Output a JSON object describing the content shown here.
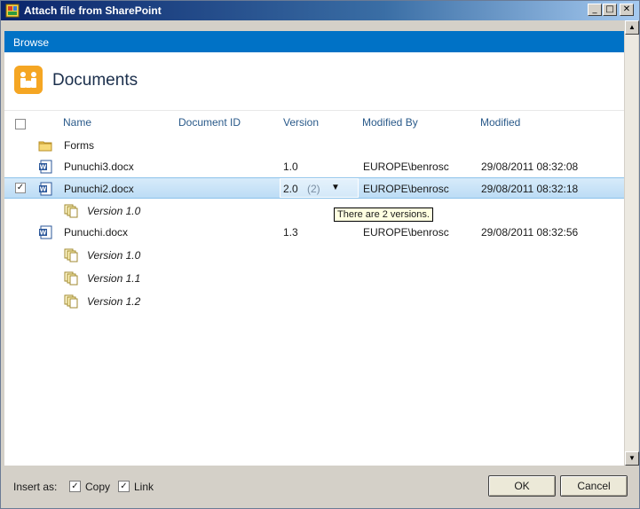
{
  "window": {
    "title": "Attach file from SharePoint",
    "min_glyph": "_",
    "max_glyph": "□",
    "close_glyph": "✕"
  },
  "ribbon": {
    "tab_label": "Browse"
  },
  "library": {
    "title": "Documents"
  },
  "columns": {
    "name": "Name",
    "document_id": "Document ID",
    "version": "Version",
    "modified_by": "Modified By",
    "modified": "Modified"
  },
  "rows": [
    {
      "type": "folder",
      "name": "Forms"
    },
    {
      "type": "file",
      "name": "Punuchi3.docx",
      "version": "1.0",
      "modified_by": "EUROPE\\benrosc",
      "modified": "29/08/2011 08:32:08"
    },
    {
      "type": "file",
      "name": "Punuchi2.docx",
      "version": "2.0",
      "version_count": "(2)",
      "modified_by": "EUROPE\\benrosc",
      "modified": "29/08/2011 08:32:18",
      "selected": true,
      "checked": "✓"
    },
    {
      "type": "version",
      "name": "Version 1.0"
    },
    {
      "type": "file",
      "name": "Punuchi.docx",
      "version": "1.3",
      "modified_by": "EUROPE\\benrosc",
      "modified": "29/08/2011 08:32:56"
    },
    {
      "type": "version",
      "name": "Version 1.0"
    },
    {
      "type": "version",
      "name": "Version 1.1"
    },
    {
      "type": "version",
      "name": "Version 1.2"
    }
  ],
  "tooltip": {
    "text": "There are 2  versions."
  },
  "footer": {
    "insert_as_label": "Insert as:",
    "copy_label": "Copy",
    "copy_checked": "✓",
    "link_label": "Link",
    "link_checked": "✓",
    "ok_label": "OK",
    "cancel_label": "Cancel"
  },
  "colors": {
    "ribbon": "#0072c6",
    "selected_row": "#bcdcf5",
    "header_text": "#2a5a8a"
  },
  "icons": {
    "folder": "folder-icon",
    "word_doc": "word-document-icon",
    "version": "version-icon",
    "library": "documents-library-icon"
  }
}
